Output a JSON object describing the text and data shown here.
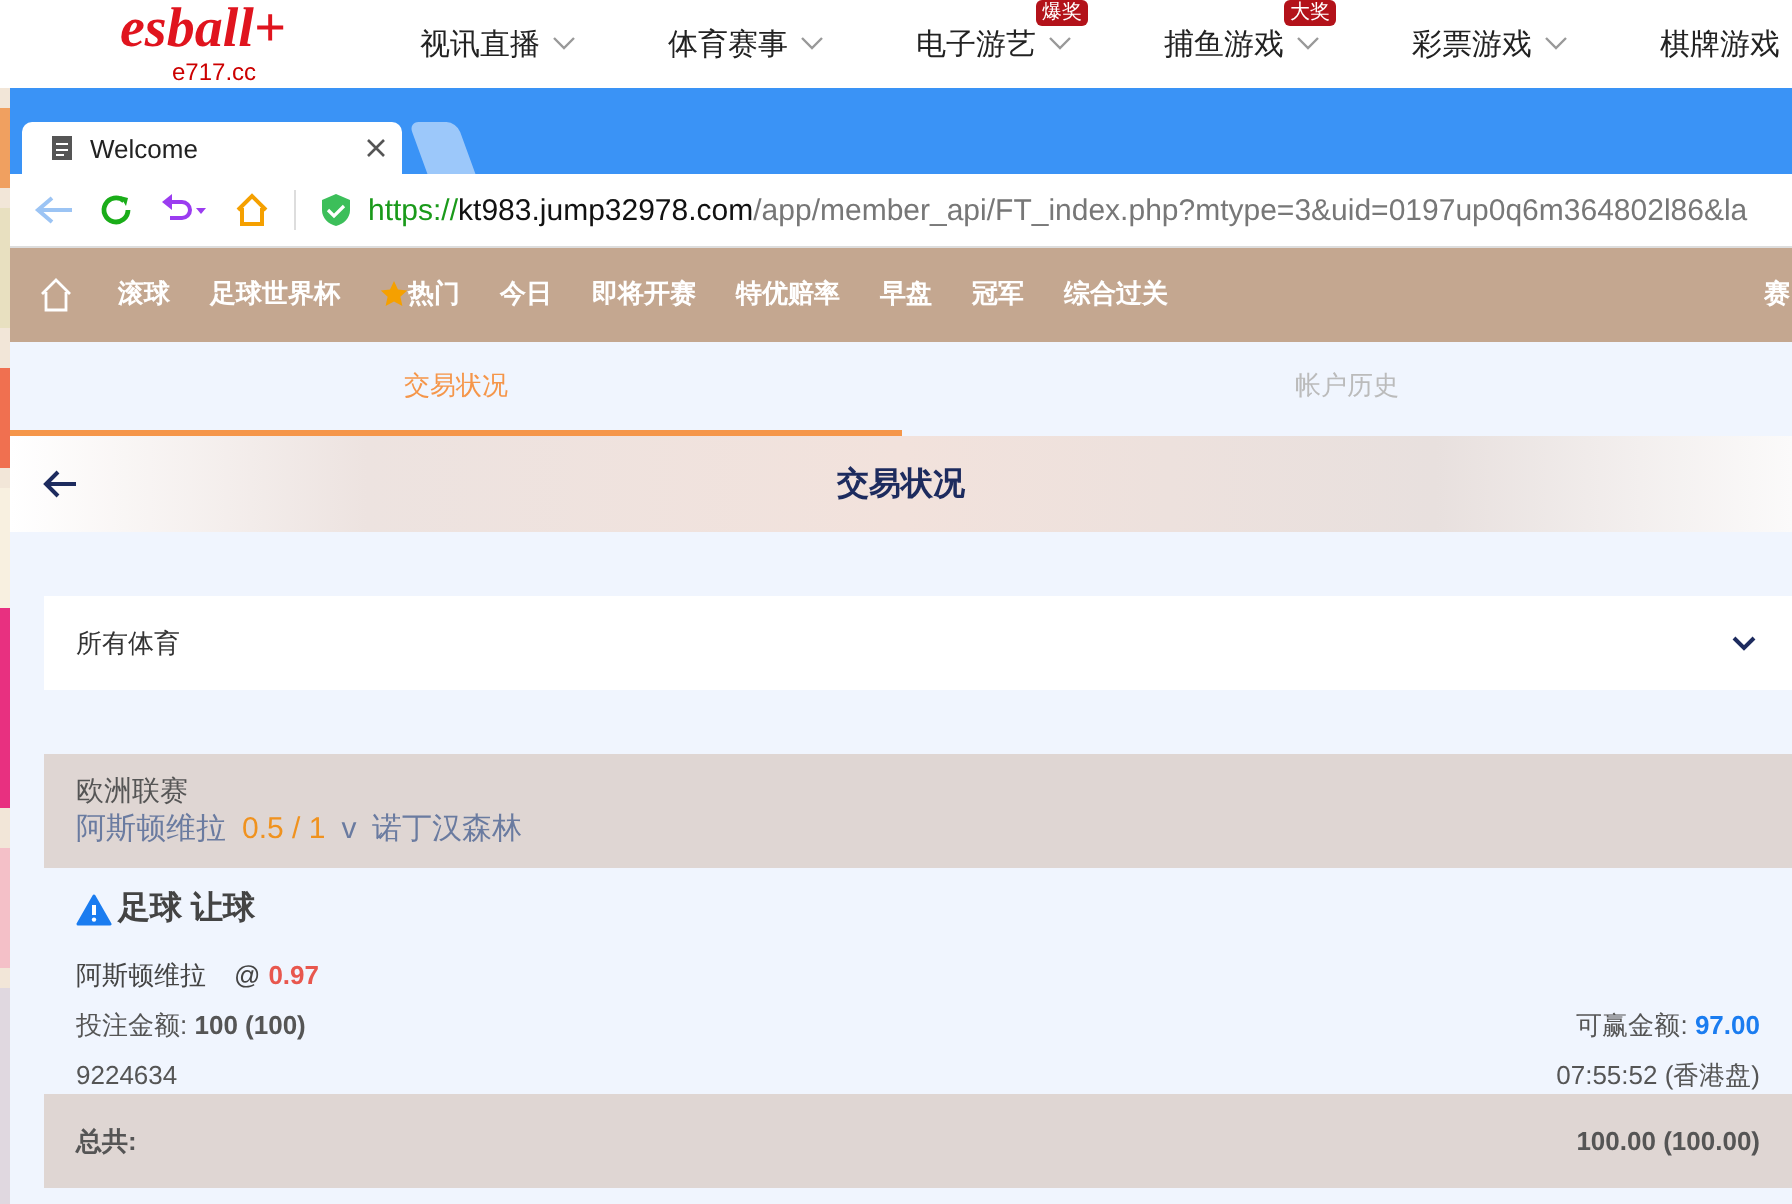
{
  "site": {
    "logo": "esball+",
    "domain": "e717.cc",
    "nav": [
      {
        "label": "视讯直播"
      },
      {
        "label": "体育赛事"
      },
      {
        "label": "电子游艺",
        "badge": "爆奖"
      },
      {
        "label": "捕鱼游戏",
        "badge": "大奖"
      },
      {
        "label": "彩票游戏"
      },
      {
        "label": "棋牌游戏"
      }
    ]
  },
  "browser": {
    "tabs": [
      {
        "title": "Welcome",
        "selected": true
      },
      {
        "selected": false
      }
    ],
    "url": {
      "scheme": "https://",
      "host": "kt983.jump32978.com",
      "path": "/app/member_api/FT_index.php?mtype=3&uid=0197up0q6m364802l86&la"
    }
  },
  "menu": [
    {
      "label": "滚球",
      "kind": "text"
    },
    {
      "label": "足球世界杯",
      "kind": "text"
    },
    {
      "label": "热门",
      "kind": "star"
    },
    {
      "label": "今日",
      "kind": "text"
    },
    {
      "label": "即将开赛",
      "kind": "text"
    },
    {
      "label": "特优赔率",
      "kind": "text"
    },
    {
      "label": "早盘",
      "kind": "text"
    },
    {
      "label": "冠军",
      "kind": "text"
    },
    {
      "label": "综合过关",
      "kind": "text"
    },
    {
      "label": "赛",
      "kind": "right"
    }
  ],
  "tabs": [
    {
      "label": "交易状况",
      "selected": true
    },
    {
      "label": "帐户历史",
      "selected": false
    }
  ],
  "header": {
    "title": "交易状况"
  },
  "filter": {
    "value": "所有体育"
  },
  "bet": {
    "league": "欧洲联赛",
    "home": "阿斯顿维拉",
    "handicap": "0.5 / 1",
    "vs": "v",
    "away": "诺丁汉森林",
    "title": "足球 让球",
    "selection": "阿斯顿维拉",
    "at": "@",
    "odds": "0.97",
    "stake_label": "投注金额:",
    "stake": "100 (100)",
    "win_label": "可赢金额:",
    "win": "97.00",
    "ticket": "9224634",
    "time": "07:55:52 (香港盘)"
  },
  "total": {
    "label": "总共:",
    "value": "100.00 (100.00)"
  }
}
